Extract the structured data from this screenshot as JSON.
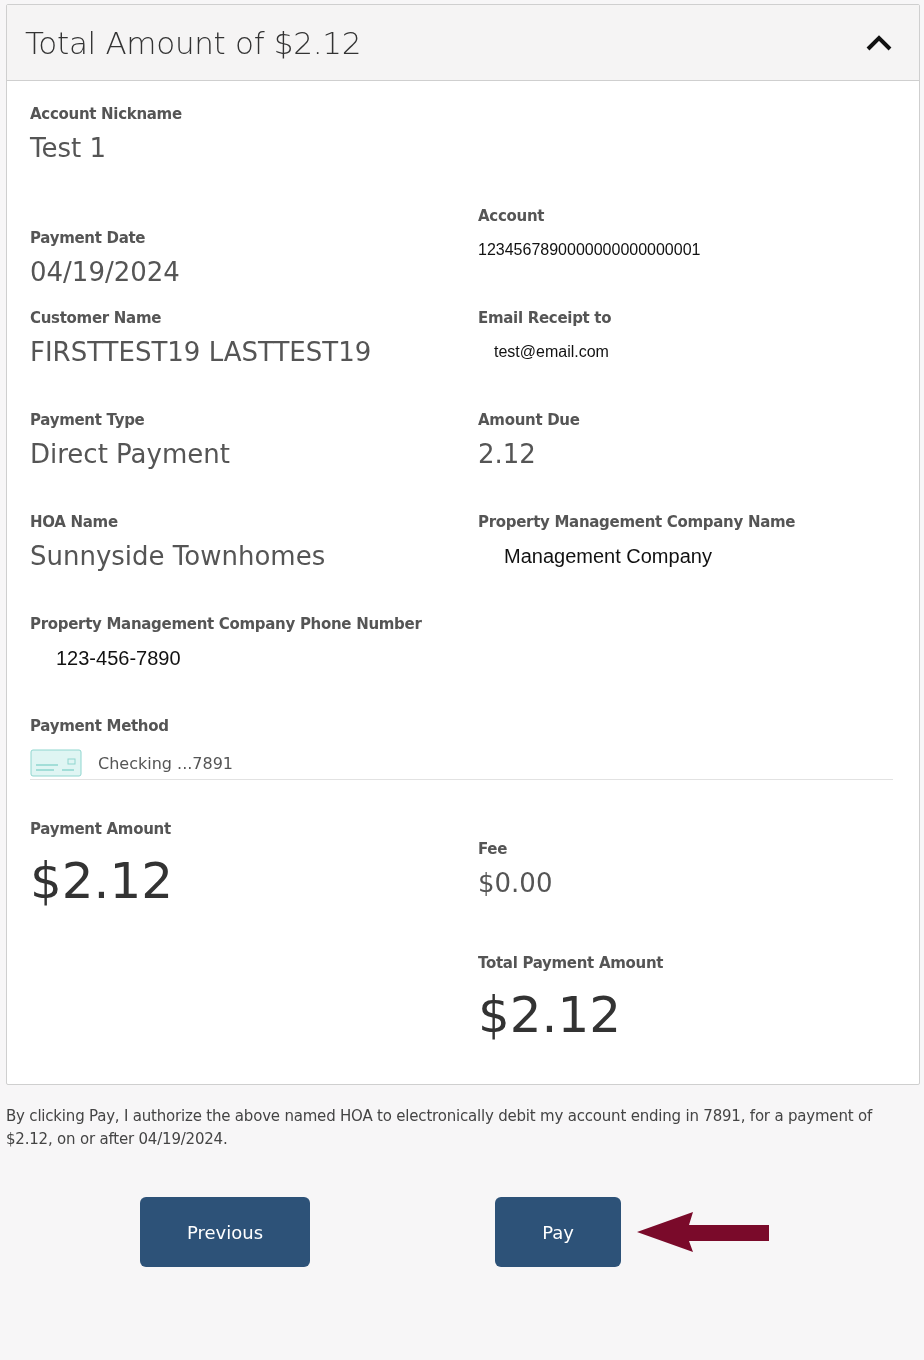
{
  "panel": {
    "title": "Total Amount of $2.12",
    "expanded": true
  },
  "rows": [
    [
      {
        "label": "Account Nickname",
        "value": "Test 1",
        "kind": "text"
      }
    ],
    [
      {
        "label": "Payment Date",
        "value": "04/19/2024",
        "kind": "text"
      },
      {
        "label": "Account",
        "value": "1234567890000000000000001",
        "kind": "small"
      }
    ],
    [
      {
        "label": "Customer Name",
        "value": "FIRSTTEST19 LASTTEST19",
        "kind": "text"
      },
      {
        "label": "Email Receipt to",
        "value": "test@email.com",
        "kind": "small"
      }
    ],
    [
      {
        "label": "Payment Type",
        "value": "Direct Payment",
        "kind": "text"
      },
      {
        "label": "Amount Due",
        "value": "2.12",
        "kind": "text"
      }
    ],
    [
      {
        "label": "HOA Name",
        "value": "Sunnyside Townhomes",
        "kind": "text"
      },
      {
        "label": "Property Management Company Name",
        "value": "Management Company",
        "kind": "medium"
      }
    ],
    [
      {
        "label": "Property Management Company Phone Number",
        "value": "123-456-7890",
        "kind": "medium"
      }
    ]
  ],
  "payment_method": {
    "label": "Payment Method",
    "value": "Checking ...7891"
  },
  "amounts": {
    "left": [
      {
        "label": "Payment Amount",
        "value": "$2.12",
        "kind": "big"
      }
    ],
    "right": [
      {
        "label": "Fee",
        "value": "$0.00",
        "kind": "text"
      },
      {
        "label": "Total Payment Amount",
        "value": "$2.12",
        "kind": "big"
      }
    ]
  },
  "disclaimer": "By clicking Pay, I authorize the above named HOA to electronically debit my account ending in 7891, for a payment of $2.12, on or after 04/19/2024.",
  "buttons": [
    "Previous",
    "Pay"
  ]
}
